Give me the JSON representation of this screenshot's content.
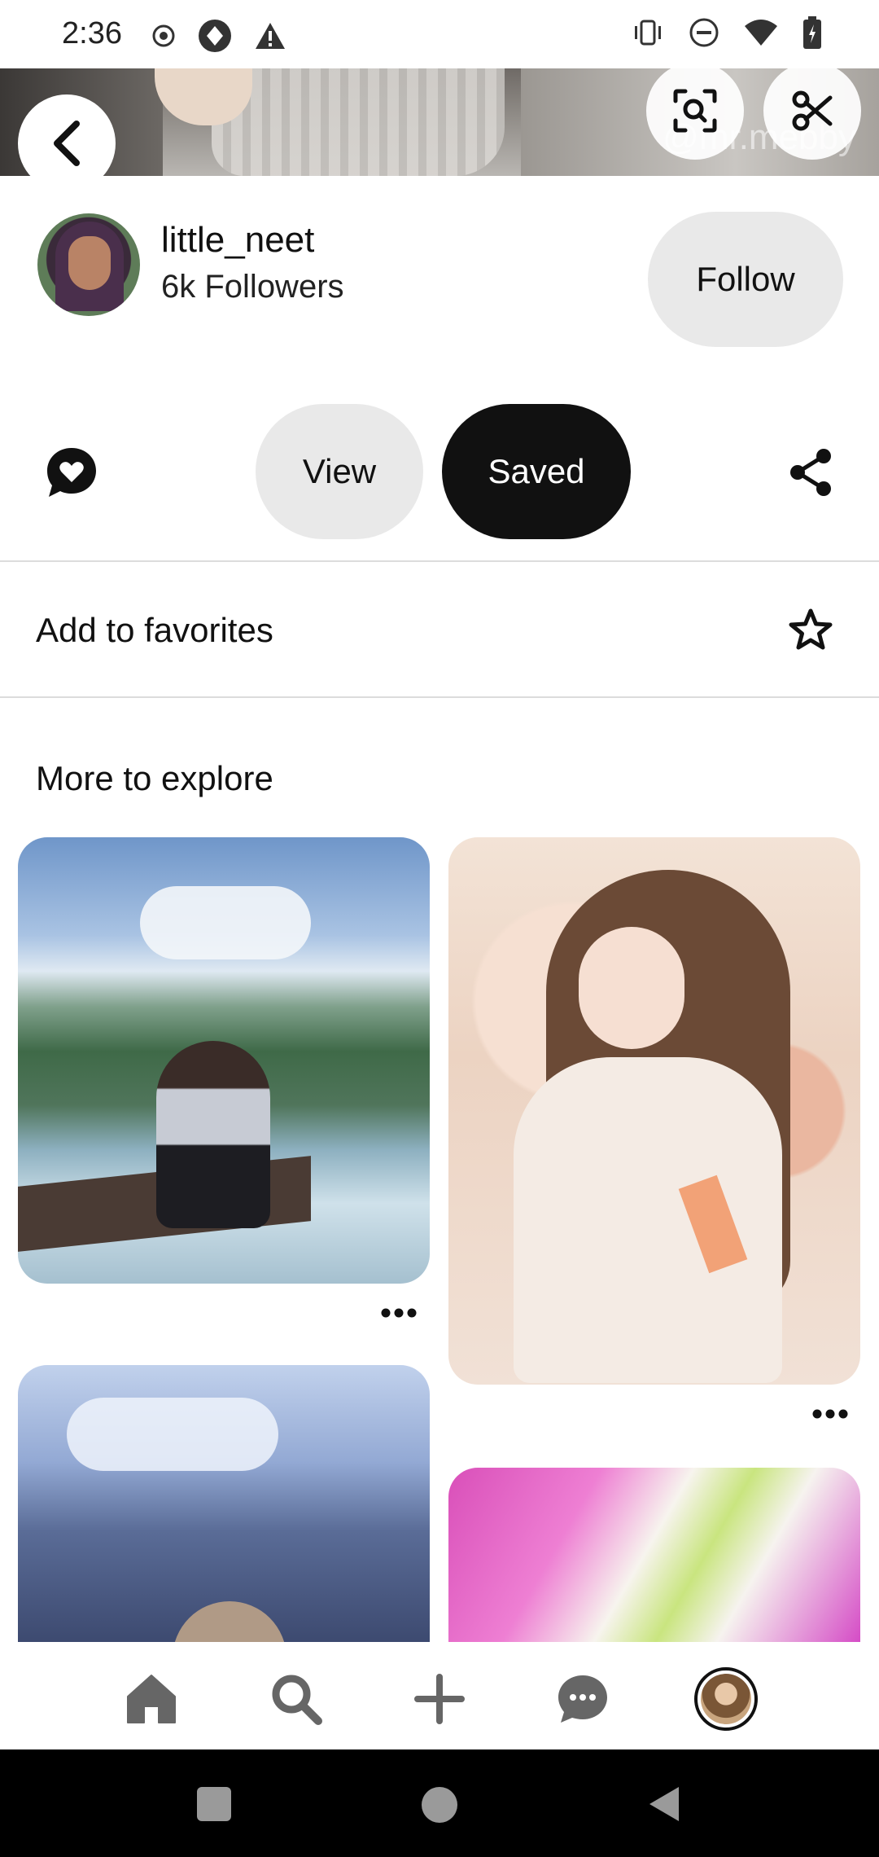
{
  "status_bar": {
    "time": "2:36",
    "left_icons": [
      "record-icon",
      "app-icon",
      "warning-icon"
    ],
    "right_icons": [
      "vibrate-icon",
      "dnd-icon",
      "wifi-icon",
      "battery-icon"
    ]
  },
  "hero": {
    "watermark": "@mr.mebby",
    "buttons": [
      "back-icon",
      "lens-icon",
      "scissors-icon"
    ]
  },
  "profile": {
    "username": "little_neet",
    "followers": "6k Followers",
    "follow_label": "Follow"
  },
  "actions": {
    "view_label": "View",
    "saved_label": "Saved",
    "reaction_icon": "heart-chat-icon",
    "share_icon": "share-icon"
  },
  "favorites": {
    "label": "Add to favorites",
    "icon": "star-icon"
  },
  "explore": {
    "title": "More to explore"
  },
  "bottom_nav": {
    "items": [
      "home-icon",
      "search-icon",
      "create-icon",
      "messages-icon",
      "profile-avatar"
    ]
  },
  "colors": {
    "primary_dark": "#111111",
    "pill_gray": "#e9e9e9",
    "divider": "#dcdcdc"
  }
}
